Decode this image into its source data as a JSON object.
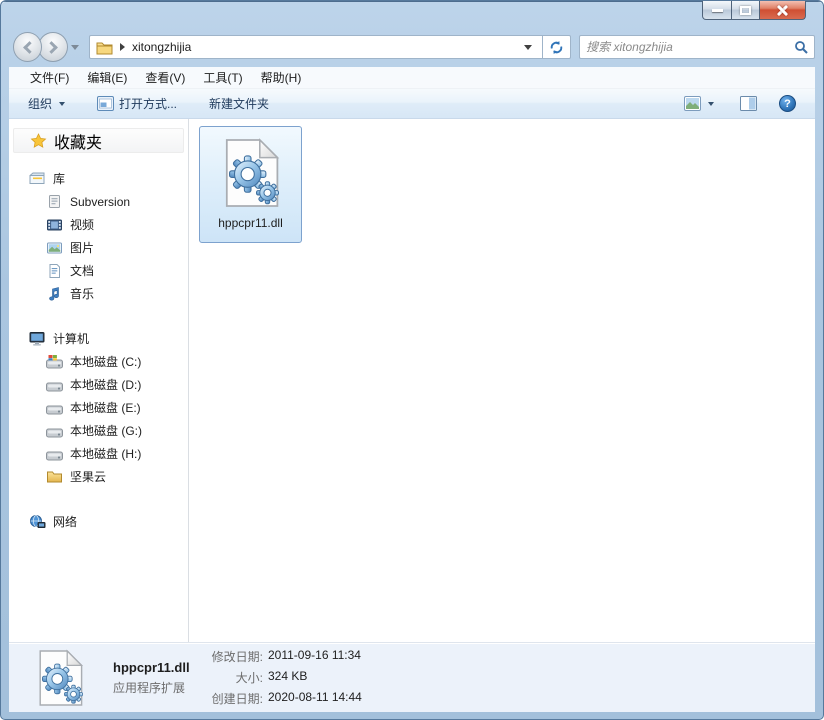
{
  "navbar": {
    "breadcrumb": "xitongzhijia",
    "search_placeholder": "搜索 xitongzhijia"
  },
  "menubar": {
    "items": [
      {
        "label": "文件(F)"
      },
      {
        "label": "编辑(E)"
      },
      {
        "label": "查看(V)"
      },
      {
        "label": "工具(T)"
      },
      {
        "label": "帮助(H)"
      }
    ]
  },
  "toolbar": {
    "organize": "组织",
    "open_with": "打开方式...",
    "new_folder": "新建文件夹"
  },
  "sidebar": {
    "favorites_label": "收藏夹",
    "libraries_label": "库",
    "library_items": [
      "Subversion",
      "视频",
      "图片",
      "文档",
      "音乐"
    ],
    "computer_label": "计算机",
    "computer_items": [
      "本地磁盘 (C:)",
      "本地磁盘 (D:)",
      "本地磁盘 (E:)",
      "本地磁盘 (G:)",
      "本地磁盘 (H:)",
      "坚果云"
    ],
    "network_label": "网络"
  },
  "main": {
    "file_name": "hppcpr11.dll"
  },
  "details": {
    "file_name": "hppcpr11.dll",
    "file_type": "应用程序扩展",
    "modified_label": "修改日期:",
    "modified_value": "2011-09-16 11:34",
    "size_label": "大小:",
    "size_value": "324 KB",
    "created_label": "创建日期:",
    "created_value": "2020-08-11 14:44"
  },
  "icons": {
    "help_glyph": "?",
    "accent_color": "#2f74b8",
    "selection_border_color": "#7da2ce",
    "close_button_color": "#d05d4a"
  }
}
